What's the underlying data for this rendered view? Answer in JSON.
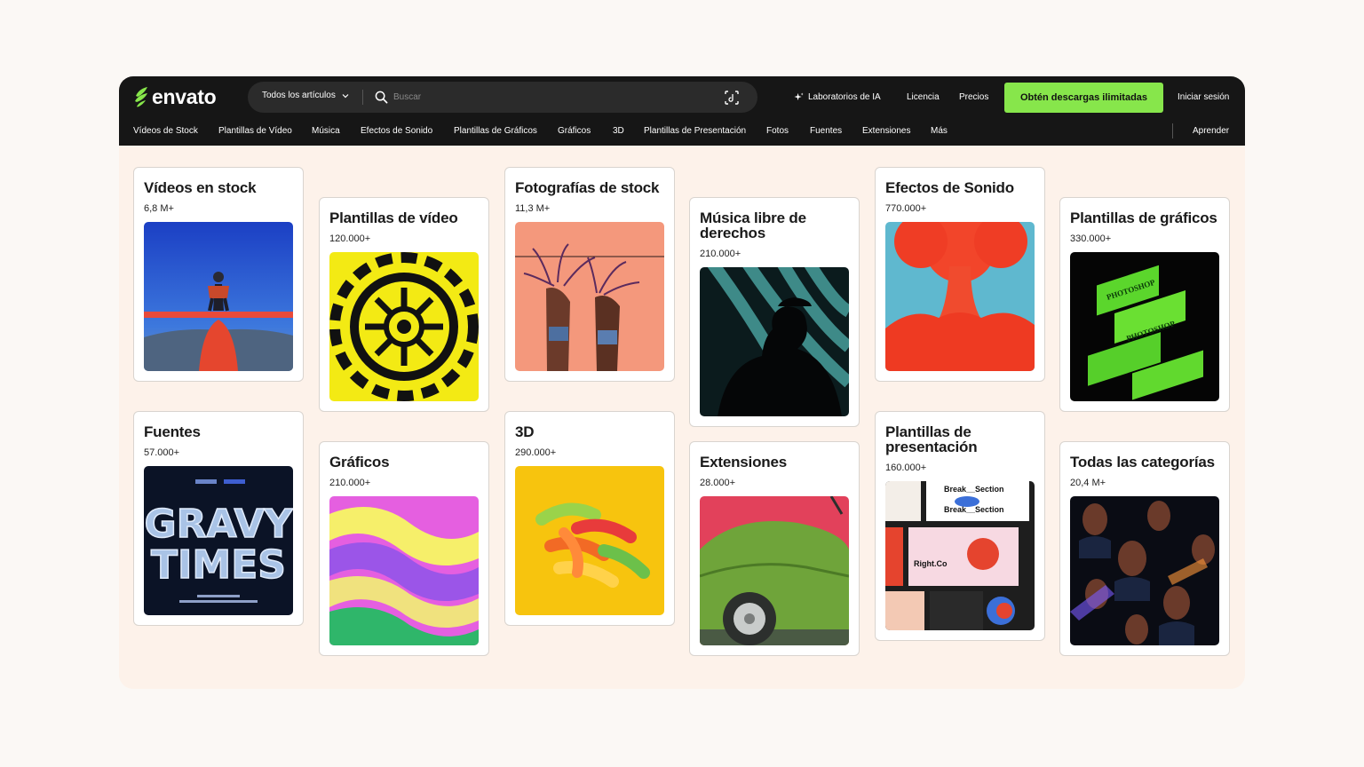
{
  "header": {
    "logo": "envato",
    "search": {
      "category": "Todos los artículos",
      "placeholder": "Buscar"
    },
    "nav": {
      "ai_labs": "Laboratorios de IA",
      "license": "Licencia",
      "pricing": "Precios",
      "cta": "Obtén descargas ilimitadas",
      "login": "Iniciar sesión"
    },
    "categories": [
      "Vídeos de Stock",
      "Plantillas de Vídeo",
      "Música",
      "Efectos de Sonido",
      "Plantillas de Gráficos",
      "Gráficos",
      "3D",
      "Plantillas de Presentación",
      "Fotos",
      "Fuentes",
      "Extensiones",
      "Más"
    ],
    "learn": "Aprender"
  },
  "cards": [
    {
      "title": "Vídeos en stock",
      "count": "6,8 M+"
    },
    {
      "title": "Plantillas de vídeo",
      "count": "120.000+"
    },
    {
      "title": "Fotografías de stock",
      "count": "11,3 M+"
    },
    {
      "title": "Música libre de derechos",
      "count": "210.000+"
    },
    {
      "title": "Efectos de Sonido",
      "count": "770.000+"
    },
    {
      "title": "Plantillas de gráficos",
      "count": "330.000+"
    },
    {
      "title": "Fuentes",
      "count": "57.000+"
    },
    {
      "title": "Gráficos",
      "count": "210.000+"
    },
    {
      "title": "3D",
      "count": "290.000+"
    },
    {
      "title": "Extensiones",
      "count": "28.000+"
    },
    {
      "title": "Plantillas de presentación",
      "count": "160.000+"
    },
    {
      "title": "Todas las categorías",
      "count": "20,4 M+"
    }
  ],
  "image_text": {
    "font_art": [
      "GRAVY",
      "TIMES"
    ],
    "presentation_break": "Break__Section",
    "presentation_brand": "Right.Co",
    "photoshop_mockup": "PHOTOSHOP"
  },
  "colors": {
    "header_bg": "#161616",
    "cta_bg": "#87e64b",
    "page_bg": "#fdf2ea"
  },
  "icons": {
    "logo": "envato-leaf-icon",
    "search": "search-icon",
    "scan": "image-search-icon",
    "ai": "sparkle-icon",
    "dropdown": "chevron-down-icon"
  }
}
